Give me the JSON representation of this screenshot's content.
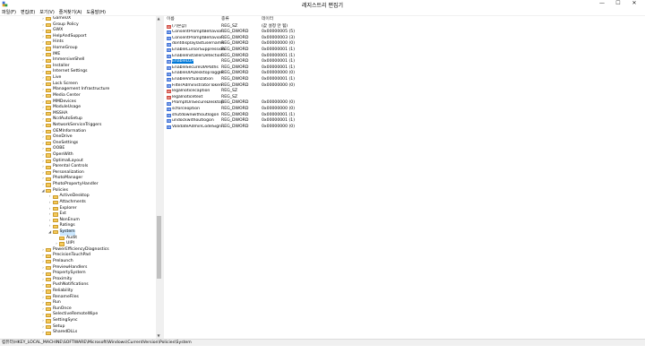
{
  "window": {
    "title": "레지스트리 편집기",
    "controls": {
      "minimize": "—",
      "maximize": "☐",
      "close": "✕"
    }
  },
  "menu": [
    "파일(F)",
    "편집(E)",
    "보기(V)",
    "즐겨찾기(A)",
    "도움말(H)"
  ],
  "tree": {
    "items": [
      {
        "label": "GameUX",
        "depth": 0,
        "expander": "›"
      },
      {
        "label": "Group Policy",
        "depth": 0,
        "expander": "›"
      },
      {
        "label": "GWX",
        "depth": 0,
        "expander": "›"
      },
      {
        "label": "HelpAndSupport",
        "depth": 0,
        "expander": "›"
      },
      {
        "label": "Hints",
        "depth": 0,
        "expander": "›"
      },
      {
        "label": "HomeGroup",
        "depth": 0,
        "expander": "›"
      },
      {
        "label": "IME",
        "depth": 0,
        "expander": "›"
      },
      {
        "label": "ImmersiveShell",
        "depth": 0,
        "expander": "›"
      },
      {
        "label": "Installer",
        "depth": 0,
        "expander": "›"
      },
      {
        "label": "Internet Settings",
        "depth": 0,
        "expander": "›"
      },
      {
        "label": "Live",
        "depth": 0,
        "expander": "›"
      },
      {
        "label": "Lock Screen",
        "depth": 0,
        "expander": "›"
      },
      {
        "label": "Management Infrastructure",
        "depth": 0,
        "expander": "›"
      },
      {
        "label": "Media Center",
        "depth": 0,
        "expander": "›"
      },
      {
        "label": "MMDevices",
        "depth": 0,
        "expander": "›"
      },
      {
        "label": "ModuleUsage",
        "depth": 0,
        "expander": "›"
      },
      {
        "label": "MSSHA",
        "depth": 0,
        "expander": "›"
      },
      {
        "label": "NcdAutoSetup",
        "depth": 0,
        "expander": "›"
      },
      {
        "label": "NetworkServiceTriggers",
        "depth": 0,
        "expander": "›"
      },
      {
        "label": "OEMInformation",
        "depth": 0,
        "expander": "›"
      },
      {
        "label": "OneDrive",
        "depth": 0,
        "expander": "›"
      },
      {
        "label": "OneSettings",
        "depth": 0,
        "expander": "›"
      },
      {
        "label": "OOBE",
        "depth": 0,
        "expander": "›"
      },
      {
        "label": "OpenWith",
        "depth": 0,
        "expander": "›"
      },
      {
        "label": "OptimalLayout",
        "depth": 0,
        "expander": "›"
      },
      {
        "label": "Parental Controls",
        "depth": 0,
        "expander": "›"
      },
      {
        "label": "Personalization",
        "depth": 0,
        "expander": "›"
      },
      {
        "label": "PhotoManager",
        "depth": 0,
        "expander": "›"
      },
      {
        "label": "PhotoPropertyHandler",
        "depth": 0,
        "expander": "›"
      },
      {
        "label": "Policies",
        "depth": 0,
        "expander": "◢"
      },
      {
        "label": "ActiveDesktop",
        "depth": 1,
        "expander": "›"
      },
      {
        "label": "Attachments",
        "depth": 1,
        "expander": "›"
      },
      {
        "label": "Explorer",
        "depth": 1,
        "expander": "›"
      },
      {
        "label": "Ext",
        "depth": 1,
        "expander": "›"
      },
      {
        "label": "NonEnum",
        "depth": 1,
        "expander": "›"
      },
      {
        "label": "Ratings",
        "depth": 1,
        "expander": "›"
      },
      {
        "label": "System",
        "depth": 1,
        "expander": "◢",
        "selected": true
      },
      {
        "label": "Audit",
        "depth": 2,
        "expander": ""
      },
      {
        "label": "UIPI",
        "depth": 2,
        "expander": "›"
      },
      {
        "label": "PowerEfficiencyDiagnostics",
        "depth": 0,
        "expander": "›"
      },
      {
        "label": "PrecisionTouchPad",
        "depth": 0,
        "expander": "›"
      },
      {
        "label": "Prelaunch",
        "depth": 0,
        "expander": "›"
      },
      {
        "label": "PreviewHandlers",
        "depth": 0,
        "expander": "›"
      },
      {
        "label": "PropertySystem",
        "depth": 0,
        "expander": "›"
      },
      {
        "label": "Proximity",
        "depth": 0,
        "expander": "›"
      },
      {
        "label": "PushNotifications",
        "depth": 0,
        "expander": "›"
      },
      {
        "label": "Reliability",
        "depth": 0,
        "expander": "›"
      },
      {
        "label": "RenameFiles",
        "depth": 0,
        "expander": "›"
      },
      {
        "label": "Run",
        "depth": 0,
        "expander": "›"
      },
      {
        "label": "RunOnce",
        "depth": 0,
        "expander": "›"
      },
      {
        "label": "SelectiveRemoteWipe",
        "depth": 0,
        "expander": "›"
      },
      {
        "label": "SettingSync",
        "depth": 0,
        "expander": "›"
      },
      {
        "label": "Setup",
        "depth": 0,
        "expander": "›"
      },
      {
        "label": "SharedDLLs",
        "depth": 0,
        "expander": "›"
      }
    ]
  },
  "values_pane": {
    "columns": {
      "name": "이름",
      "type": "종류",
      "data": "데이터"
    },
    "rows": [
      {
        "icon": "sz",
        "name": "(기본값)",
        "type": "REG_SZ",
        "data": "(값 설정 안 됨)"
      },
      {
        "icon": "dw",
        "name": "ConsentPromptBehavior...",
        "type": "REG_DWORD",
        "data": "0x00000005 (5)"
      },
      {
        "icon": "dw",
        "name": "ConsentPromptBehavior...",
        "type": "REG_DWORD",
        "data": "0x00000003 (3)"
      },
      {
        "icon": "dw",
        "name": "dontdisplaylastusername",
        "type": "REG_DWORD",
        "data": "0x00000000 (0)"
      },
      {
        "icon": "dw",
        "name": "EnableCursorSuppression",
        "type": "REG_DWORD",
        "data": "0x00000001 (1)"
      },
      {
        "icon": "dw",
        "name": "EnableInstallerDetection",
        "type": "REG_DWORD",
        "data": "0x00000001 (1)"
      },
      {
        "icon": "dw",
        "name": "EnableLUA",
        "type": "REG_DWORD",
        "data": "0x00000001 (1)",
        "selected": true
      },
      {
        "icon": "dw",
        "name": "EnableSecureUIAPaths",
        "type": "REG_DWORD",
        "data": "0x00000001 (1)"
      },
      {
        "icon": "dw",
        "name": "EnableUIADesktopToggle",
        "type": "REG_DWORD",
        "data": "0x00000000 (0)"
      },
      {
        "icon": "dw",
        "name": "EnableVirtualization",
        "type": "REG_DWORD",
        "data": "0x00000001 (1)"
      },
      {
        "icon": "dw",
        "name": "FilterAdministratorToken",
        "type": "REG_DWORD",
        "data": "0x00000000 (0)"
      },
      {
        "icon": "sz",
        "name": "legalnoticecaption",
        "type": "REG_SZ",
        "data": ""
      },
      {
        "icon": "sz",
        "name": "legalnoticetext",
        "type": "REG_SZ",
        "data": ""
      },
      {
        "icon": "dw",
        "name": "PromptOnSecureDesktop",
        "type": "REG_DWORD",
        "data": "0x00000000 (0)"
      },
      {
        "icon": "dw",
        "name": "scforceoption",
        "type": "REG_DWORD",
        "data": "0x00000000 (0)"
      },
      {
        "icon": "dw",
        "name": "shutdownwithoutlogon",
        "type": "REG_DWORD",
        "data": "0x00000001 (1)"
      },
      {
        "icon": "dw",
        "name": "undockwithoutlogon",
        "type": "REG_DWORD",
        "data": "0x00000001 (1)"
      },
      {
        "icon": "dw",
        "name": "ValidateAdminCodeSign...",
        "type": "REG_DWORD",
        "data": "0x00000000 (0)"
      }
    ],
    "icon_labels": {
      "sz": "ab",
      "dw": "01"
    }
  },
  "statusbar": {
    "path": "컴퓨터\\HKEY_LOCAL_MACHINE\\SOFTWARE\\Microsoft\\Windows\\CurrentVersion\\Policies\\System"
  },
  "colors": {
    "selection": "#0078d7",
    "folder": "#f5c95a"
  }
}
